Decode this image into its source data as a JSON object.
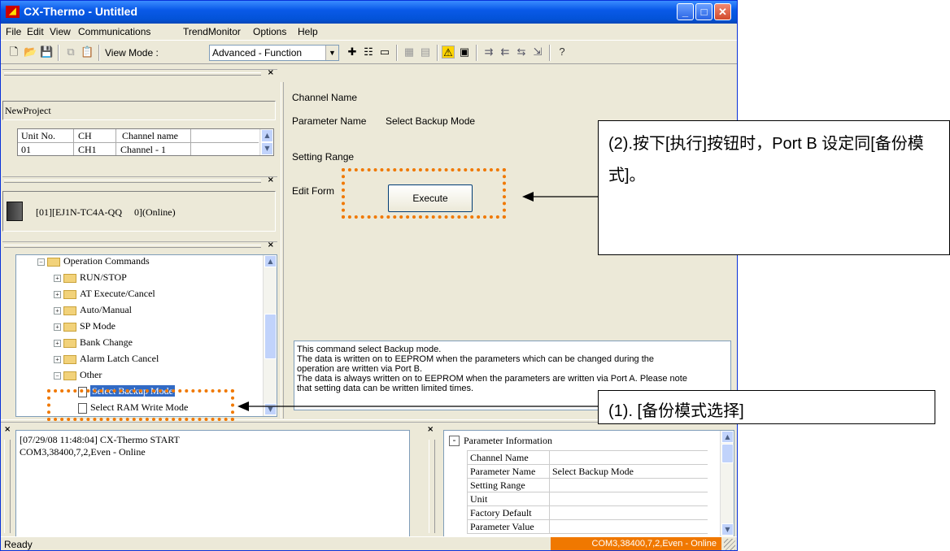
{
  "window": {
    "title": "CX-Thermo - Untitled"
  },
  "menu": [
    "File",
    "Edit",
    "View",
    "Communications",
    "TrendMonitor",
    "Options",
    "Help"
  ],
  "toolbar": {
    "view_mode_label": "View Mode :",
    "view_mode_value": "Advanced - Function"
  },
  "project": {
    "name": "NewProject"
  },
  "unit_table": {
    "headers": [
      "Unit No.",
      "CH",
      "Channel name"
    ],
    "rows": [
      [
        "01",
        "CH1",
        "Channel - 1"
      ]
    ]
  },
  "device": {
    "label": "[01][EJ1N-TC4A-QQ     0](Online)"
  },
  "tree": {
    "items": [
      {
        "label": "Operation Commands",
        "expander": "−",
        "type": "folder-open",
        "level": 1
      },
      {
        "label": "RUN/STOP",
        "expander": "+",
        "type": "folder",
        "level": 2
      },
      {
        "label": "AT Execute/Cancel",
        "expander": "+",
        "type": "folder",
        "level": 2
      },
      {
        "label": "Auto/Manual",
        "expander": "+",
        "type": "folder",
        "level": 2
      },
      {
        "label": "SP Mode",
        "expander": "+",
        "type": "folder",
        "level": 2
      },
      {
        "label": "Bank Change",
        "expander": "+",
        "type": "folder",
        "level": 2
      },
      {
        "label": "Alarm Latch Cancel",
        "expander": "+",
        "type": "folder",
        "level": 2
      },
      {
        "label": "Other",
        "expander": "−",
        "type": "folder-open",
        "level": 2
      },
      {
        "label": "Select Backup Mode",
        "expander": "",
        "type": "doc",
        "level": 3,
        "selected": true
      },
      {
        "label": "Select RAM Write Mode",
        "expander": "",
        "type": "doc",
        "level": 3
      }
    ]
  },
  "editor": {
    "channel_name_label": "Channel Name",
    "parameter_name_label": "Parameter Name",
    "parameter_name_value": "Select Backup Mode",
    "setting_range_label": "Setting Range",
    "edit_form_label": "Edit Form",
    "execute_label": "Execute"
  },
  "description": {
    "lines": [
      "This command select Backup mode.",
      "The data is written on to EEPROM when the parameters which can be changed during the",
      "operation are written via Port B.",
      "The data is always written on to EEPROM when the parameters are written via Port A. Please note",
      "that setting data can be written limited times."
    ]
  },
  "log": {
    "lines": [
      "[07/29/08 11:48:04] CX-Thermo START",
      "COM3,38400,7,2,Even - Online"
    ]
  },
  "param_info": {
    "title": "Parameter Information",
    "collapse": "-",
    "rows": [
      [
        "Channel Name",
        ""
      ],
      [
        "Parameter Name",
        "Select Backup Mode"
      ],
      [
        "Setting Range",
        ""
      ],
      [
        "Unit",
        ""
      ],
      [
        "Factory Default",
        ""
      ],
      [
        "Parameter Value",
        ""
      ]
    ]
  },
  "status": {
    "left": "Ready",
    "right": "COM3,38400,7,2,Even - Online"
  },
  "annotations": {
    "callout2": "(2).按下[执行]按钮时，Port B 设定同[备份模式]。",
    "callout1": "(1). [备份模式选择]"
  },
  "colors": {
    "titlebar": "#0353d8",
    "highlight": "#f07800",
    "status_right_text": "#ffffff"
  }
}
